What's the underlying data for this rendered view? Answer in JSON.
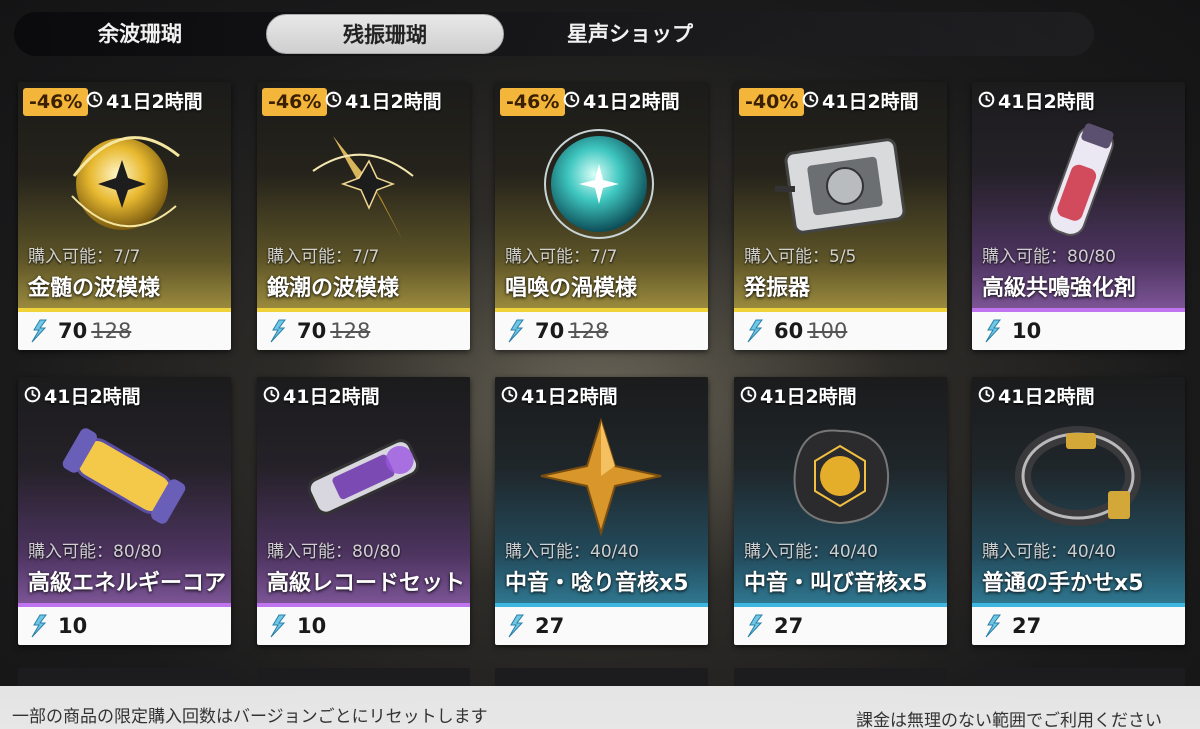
{
  "tabs": [
    {
      "label": "余波珊瑚",
      "active": false
    },
    {
      "label": "残振珊瑚",
      "active": true
    },
    {
      "label": "星声ショップ",
      "active": false
    }
  ],
  "items": [
    {
      "name": "金髄の波模様",
      "timer": "41日2時間",
      "limit": "購入可能：7/7",
      "price": "70",
      "old_price": "128",
      "discount": "-46%",
      "rarity": "gold",
      "icon": "golden-orb-icon"
    },
    {
      "name": "鍛潮の波模様",
      "timer": "41日2時間",
      "limit": "購入可能：7/7",
      "price": "70",
      "old_price": "128",
      "discount": "-46%",
      "rarity": "gold",
      "icon": "golden-blade-icon"
    },
    {
      "name": "唱喚の渦模様",
      "timer": "41日2時間",
      "limit": "購入可能：7/7",
      "price": "70",
      "old_price": "128",
      "discount": "-46%",
      "rarity": "gold",
      "icon": "teal-orb-icon"
    },
    {
      "name": "発振器",
      "timer": "41日2時間",
      "limit": "購入可能：5/5",
      "price": "60",
      "old_price": "100",
      "discount": "-40%",
      "rarity": "gold",
      "icon": "oscillator-device-icon"
    },
    {
      "name": "高級共鳴強化剤",
      "timer": "41日2時間",
      "limit": "購入可能：80/80",
      "price": "10",
      "old_price": "",
      "discount": "",
      "rarity": "purple",
      "icon": "vial-icon"
    },
    {
      "name": "高級エネルギーコア",
      "timer": "41日2時間",
      "limit": "購入可能：80/80",
      "price": "10",
      "old_price": "",
      "discount": "",
      "rarity": "purple",
      "icon": "energy-core-icon"
    },
    {
      "name": "高級レコードセット",
      "timer": "41日2時間",
      "limit": "購入可能：80/80",
      "price": "10",
      "old_price": "",
      "discount": "",
      "rarity": "purple",
      "icon": "record-set-icon"
    },
    {
      "name": "中音・唸り音核x5",
      "timer": "41日2時間",
      "limit": "購入可能：40/40",
      "price": "27",
      "old_price": "",
      "discount": "",
      "rarity": "blue",
      "icon": "star-shard-icon"
    },
    {
      "name": "中音・叫び音核x5",
      "timer": "41日2時間",
      "limit": "購入可能：40/40",
      "price": "27",
      "old_price": "",
      "discount": "",
      "rarity": "blue",
      "icon": "caged-core-icon"
    },
    {
      "name": "普通の手かせx5",
      "timer": "41日2時間",
      "limit": "購入可能：40/40",
      "price": "27",
      "old_price": "",
      "discount": "",
      "rarity": "blue",
      "icon": "shackle-ring-icon"
    }
  ],
  "footer": {
    "notice_left": "一部の商品の限定購入回数はバージョンごとにリセットします",
    "notice_right": "課金は無理のない範囲でご利用ください"
  },
  "colors": {
    "gold": "#f0d23a",
    "purple": "#c074f0",
    "blue": "#3fb6e0",
    "discount": "#f3b63a"
  }
}
